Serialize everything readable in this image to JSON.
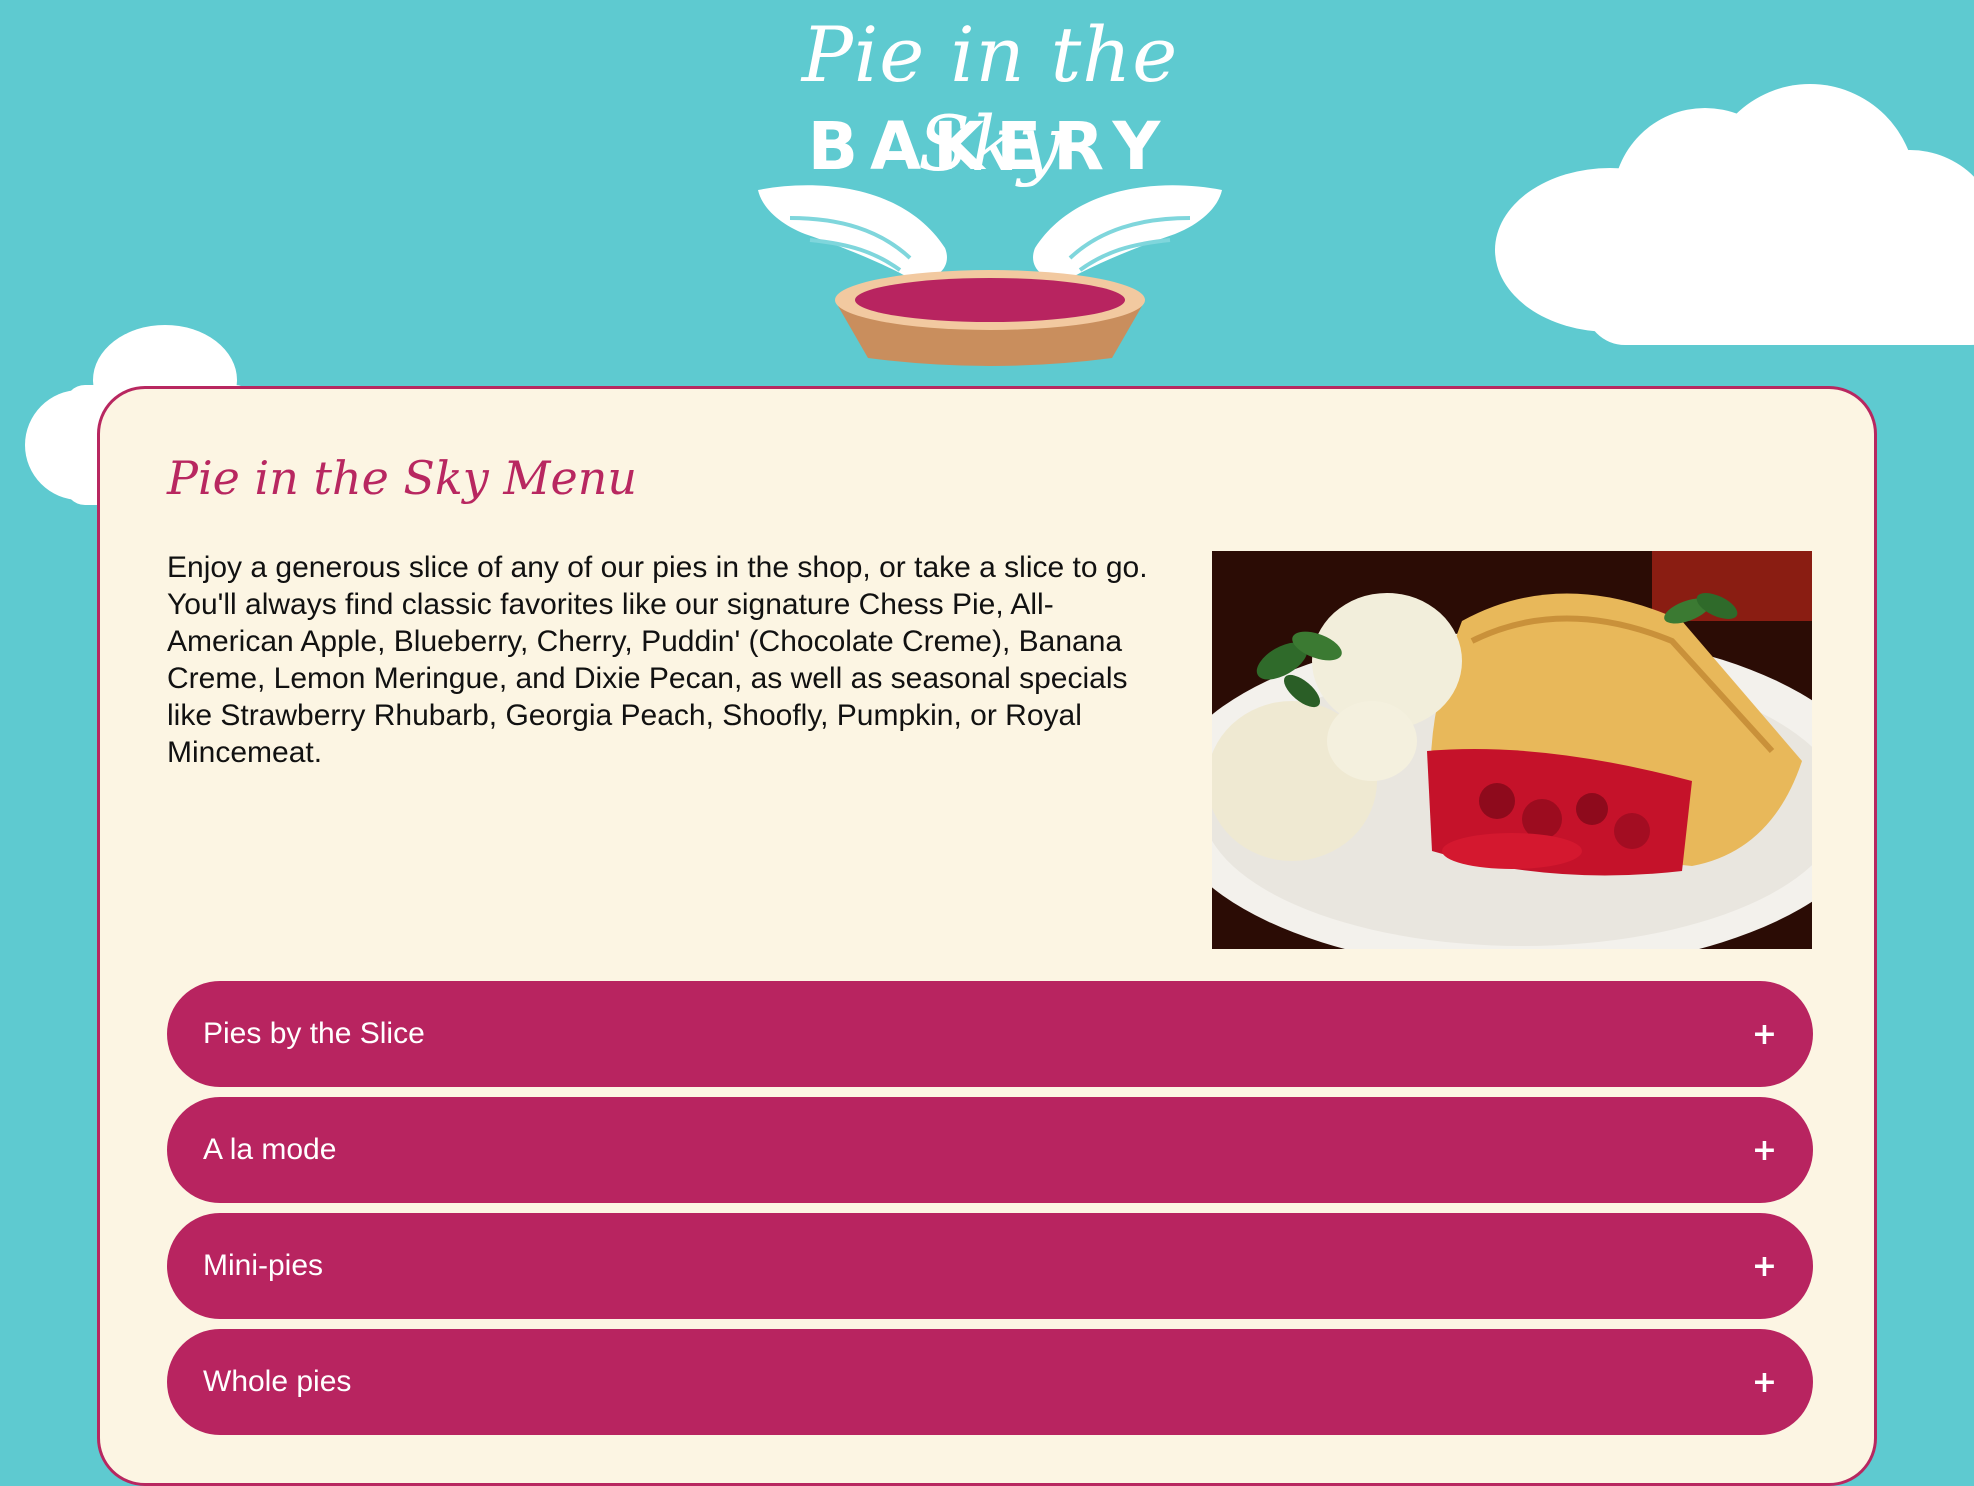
{
  "logo": {
    "title": "Pie in the Sky",
    "subtitle": "BAKERY"
  },
  "menu": {
    "title": "Pie in the Sky Menu",
    "intro": "Enjoy a generous slice of any of our pies in the shop, or take a slice to go. You'll always find classic favorites like our signature Chess Pie, All-American Apple, Blueberry, Cherry, Puddin' (Chocolate Creme), Banana Creme, Lemon Meringue, and Dixie Pecan, as well as seasonal specials like Strawberry Rhubarb, Georgia Peach, Shoofly, Pumpkin, or Royal Mincemeat.",
    "sections": [
      {
        "label": "Pies by the Slice",
        "toggle": "+"
      },
      {
        "label": "A la mode",
        "toggle": "+"
      },
      {
        "label": "Mini-pies",
        "toggle": "+"
      },
      {
        "label": "Whole pies",
        "toggle": "+"
      }
    ]
  },
  "colors": {
    "sky": "#5ecad0",
    "accent": "#b82460",
    "panel": "#fcf5e3",
    "text": "#111111"
  }
}
